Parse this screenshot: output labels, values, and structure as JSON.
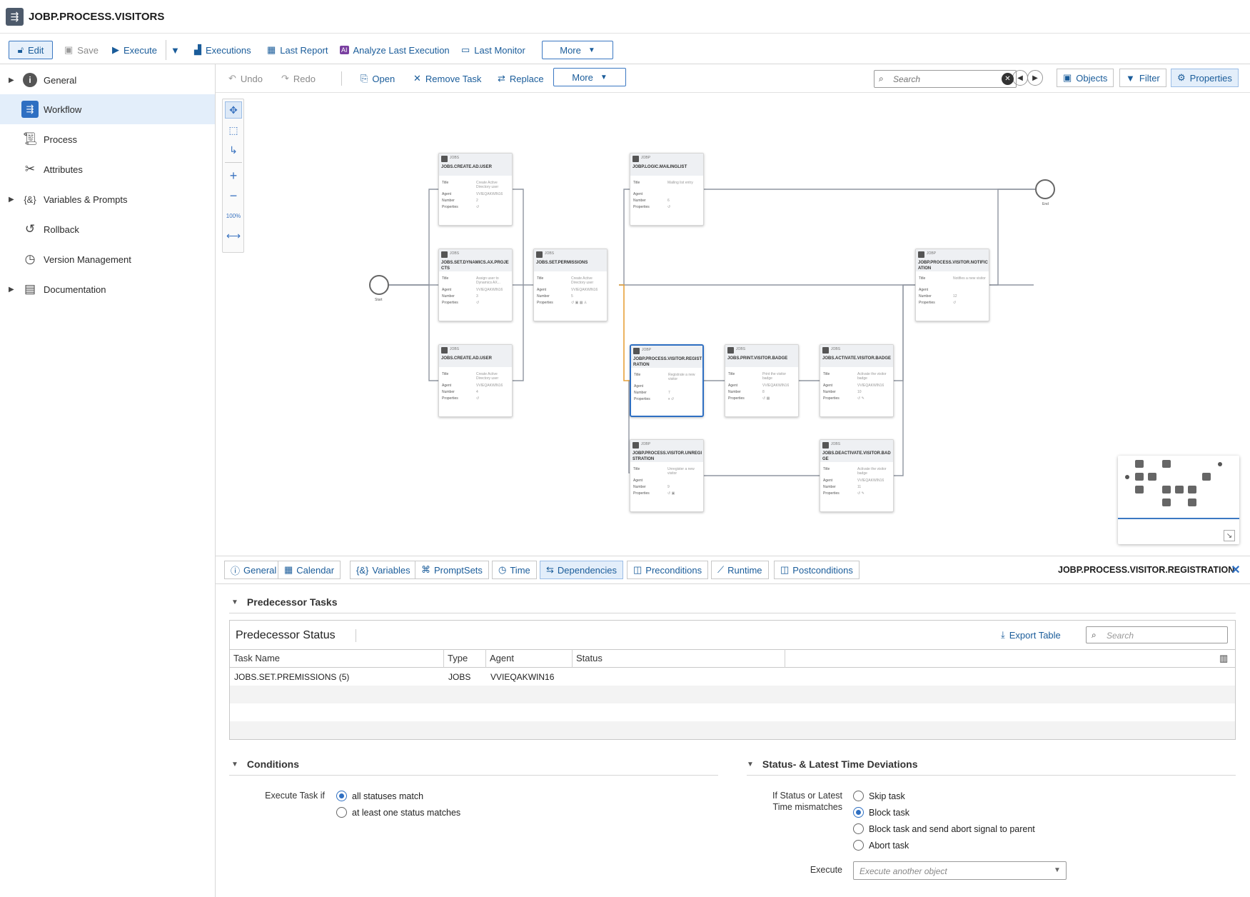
{
  "window": {
    "title": "JOBP.PROCESS.VISITORS"
  },
  "toolbar": {
    "edit": "Edit",
    "save": "Save",
    "execute": "Execute",
    "executions": "Executions",
    "last_report": "Last Report",
    "analyze": "Analyze Last Execution",
    "last_monitor": "Last Monitor",
    "more": "More"
  },
  "sidebar": {
    "items": [
      {
        "label": "General"
      },
      {
        "label": "Workflow"
      },
      {
        "label": "Process"
      },
      {
        "label": "Attributes"
      },
      {
        "label": "Variables & Prompts"
      },
      {
        "label": "Rollback"
      },
      {
        "label": "Version Management"
      },
      {
        "label": "Documentation"
      }
    ]
  },
  "wf_toolbar": {
    "undo": "Undo",
    "redo": "Redo",
    "open": "Open",
    "remove": "Remove Task",
    "replace": "Replace",
    "more": "More",
    "search_placeholder": "Search",
    "objects": "Objects",
    "filter": "Filter",
    "properties": "Properties"
  },
  "workflow": {
    "start_label": "Start",
    "end_label": "End",
    "row_labels": {
      "title": "Title",
      "agent": "Agent",
      "number": "Number",
      "properties": "Properties"
    },
    "nodes": [
      {
        "type": "JOBS",
        "name": "JOBS.CREATE.AD.USER",
        "title": "Create Active Directory user",
        "agent": "VVIEQAKWIN16",
        "number": "2",
        "props": "↺"
      },
      {
        "type": "JOBS",
        "name": "JOBS.SET.DYNAMICS.AX.PROJECTS",
        "title": "Assign user to Dynamics AX...",
        "agent": "VVIEQAKWIN16",
        "number": "3",
        "props": "↺"
      },
      {
        "type": "JOBS",
        "name": "JOBS.CREATE.AD.USER",
        "title": "Create Active Directory user",
        "agent": "VVIEQAKWIN16",
        "number": "4",
        "props": "↺"
      },
      {
        "type": "JOBS",
        "name": "JOBS.SET.PERMISSIONS",
        "title": "Create Active Directory user",
        "agent": "VVIEQAKWIN16",
        "number": "5",
        "props": "↺ ▣ ▦ ♙"
      },
      {
        "type": "JOBP",
        "name": "JOBP.LOGIC.MAILINGLIST",
        "title": "Mailing list entry",
        "agent": "",
        "number": "6",
        "props": "↺"
      },
      {
        "type": "JOBP",
        "name": "JOBP.PROCESS.VISITOR.REGISTRATION",
        "title": "Registrate a new visitor",
        "agent": "",
        "number": "7",
        "props": "⏸ ↺"
      },
      {
        "type": "JOBS",
        "name": "JOBS.PRINT.VISITOR.BADGE",
        "title": "Print the visitor badge",
        "agent": "VVIEQAKWIN16",
        "number": "8",
        "props": "↺ ▦"
      },
      {
        "type": "JOBS",
        "name": "JOBS.ACTIVATE.VISITOR.BADGE",
        "title": "Activate the visitor badge",
        "agent": "VVIEQAKWIN16",
        "number": "10",
        "props": "↺ ✎"
      },
      {
        "type": "JOBP",
        "name": "JOBP.PROCESS.VISITOR.UNREGISTRATION",
        "title": "Unregister a new visitor",
        "agent": "",
        "number": "9",
        "props": "↺ ▣"
      },
      {
        "type": "JOBS",
        "name": "JOBS.DEACTIVATE.VISITOR.BADGE",
        "title": "Activate the visitor badge",
        "agent": "VVIEQAKWIN16",
        "number": "11",
        "props": "↺ ✎"
      },
      {
        "type": "JOBP",
        "name": "JOBP.PROCESS.VISITOR.NOTIFICATION",
        "title": "Notifies a new visitor",
        "agent": "",
        "number": "12",
        "props": "↺"
      }
    ]
  },
  "bottom": {
    "tabs": [
      "General",
      "Calendar",
      "Variables",
      "PromptSets",
      "Time",
      "Dependencies",
      "Preconditions",
      "Runtime",
      "Postconditions"
    ],
    "selected_object": "JOBP.PROCESS.VISITOR.REGISTRATION",
    "predecessor_section": "Predecessor Tasks",
    "table": {
      "title": "Predecessor Status",
      "export": "Export Table",
      "search_placeholder": "Search",
      "columns": [
        "Task Name",
        "Type",
        "Agent",
        "Status"
      ],
      "rows": [
        {
          "task": "JOBS.SET.PREMISSIONS (5)",
          "type": "JOBS",
          "agent": "VVIEQAKWIN16",
          "status": ""
        }
      ]
    },
    "conditions": {
      "title": "Conditions",
      "label": "Execute Task if",
      "options": [
        "all statuses match",
        "at least one status matches"
      ],
      "selected": 0
    },
    "deviations": {
      "title": "Status- & Latest Time Deviations",
      "label_line1": "If Status or Latest",
      "label_line2": "Time mismatches",
      "options": [
        "Skip task",
        "Block task",
        "Block task and send abort signal to parent",
        "Abort task"
      ],
      "selected": 1,
      "execute_label": "Execute",
      "execute_placeholder": "Execute another object"
    }
  },
  "colors": {
    "accent": "#2e6fc2",
    "link": "#1a5c9a",
    "active_bg": "#e3eefa"
  }
}
